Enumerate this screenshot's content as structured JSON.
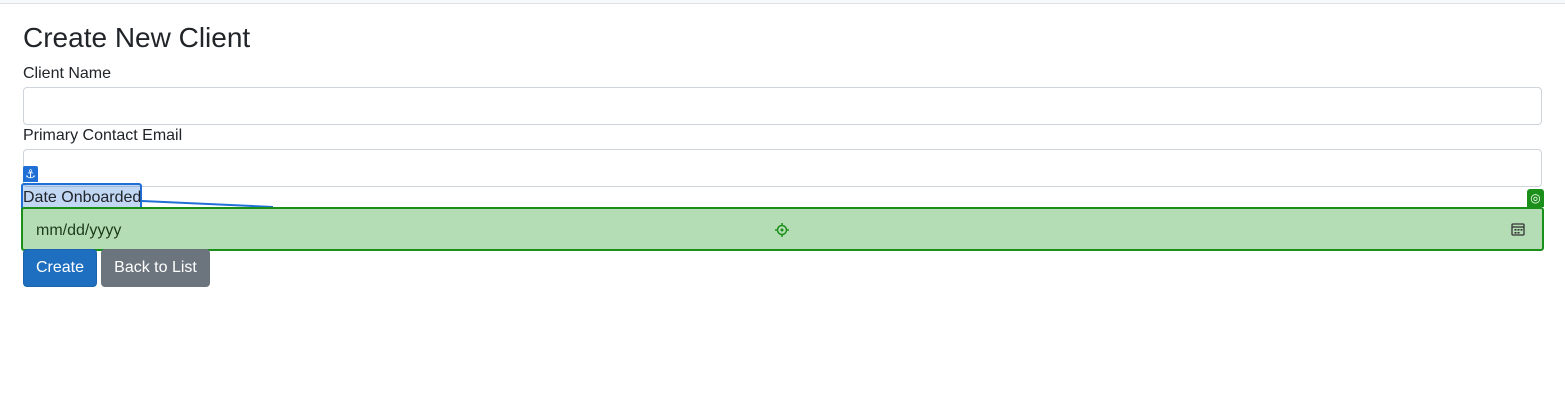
{
  "form": {
    "title": "Create New Client",
    "client_name_label": "Client Name",
    "client_name_value": "",
    "email_label": "Primary Contact Email",
    "email_value": "",
    "date_label": "Date Onboarded",
    "date_placeholder": "mm/dd/yyyy"
  },
  "buttons": {
    "create_label": "Create",
    "back_label": "Back to List"
  },
  "overlay": {
    "anchor_icon": "anchor-icon",
    "target_icon": "target-icon",
    "crosshair_icon": "crosshair-icon",
    "calendar_icon": "calendar-icon",
    "label_highlight_color": "#1f6fd6",
    "target_highlight_color": "#1a8f1a"
  },
  "colors": {
    "primary": "#1f6fc0",
    "secondary": "#6c757d"
  }
}
